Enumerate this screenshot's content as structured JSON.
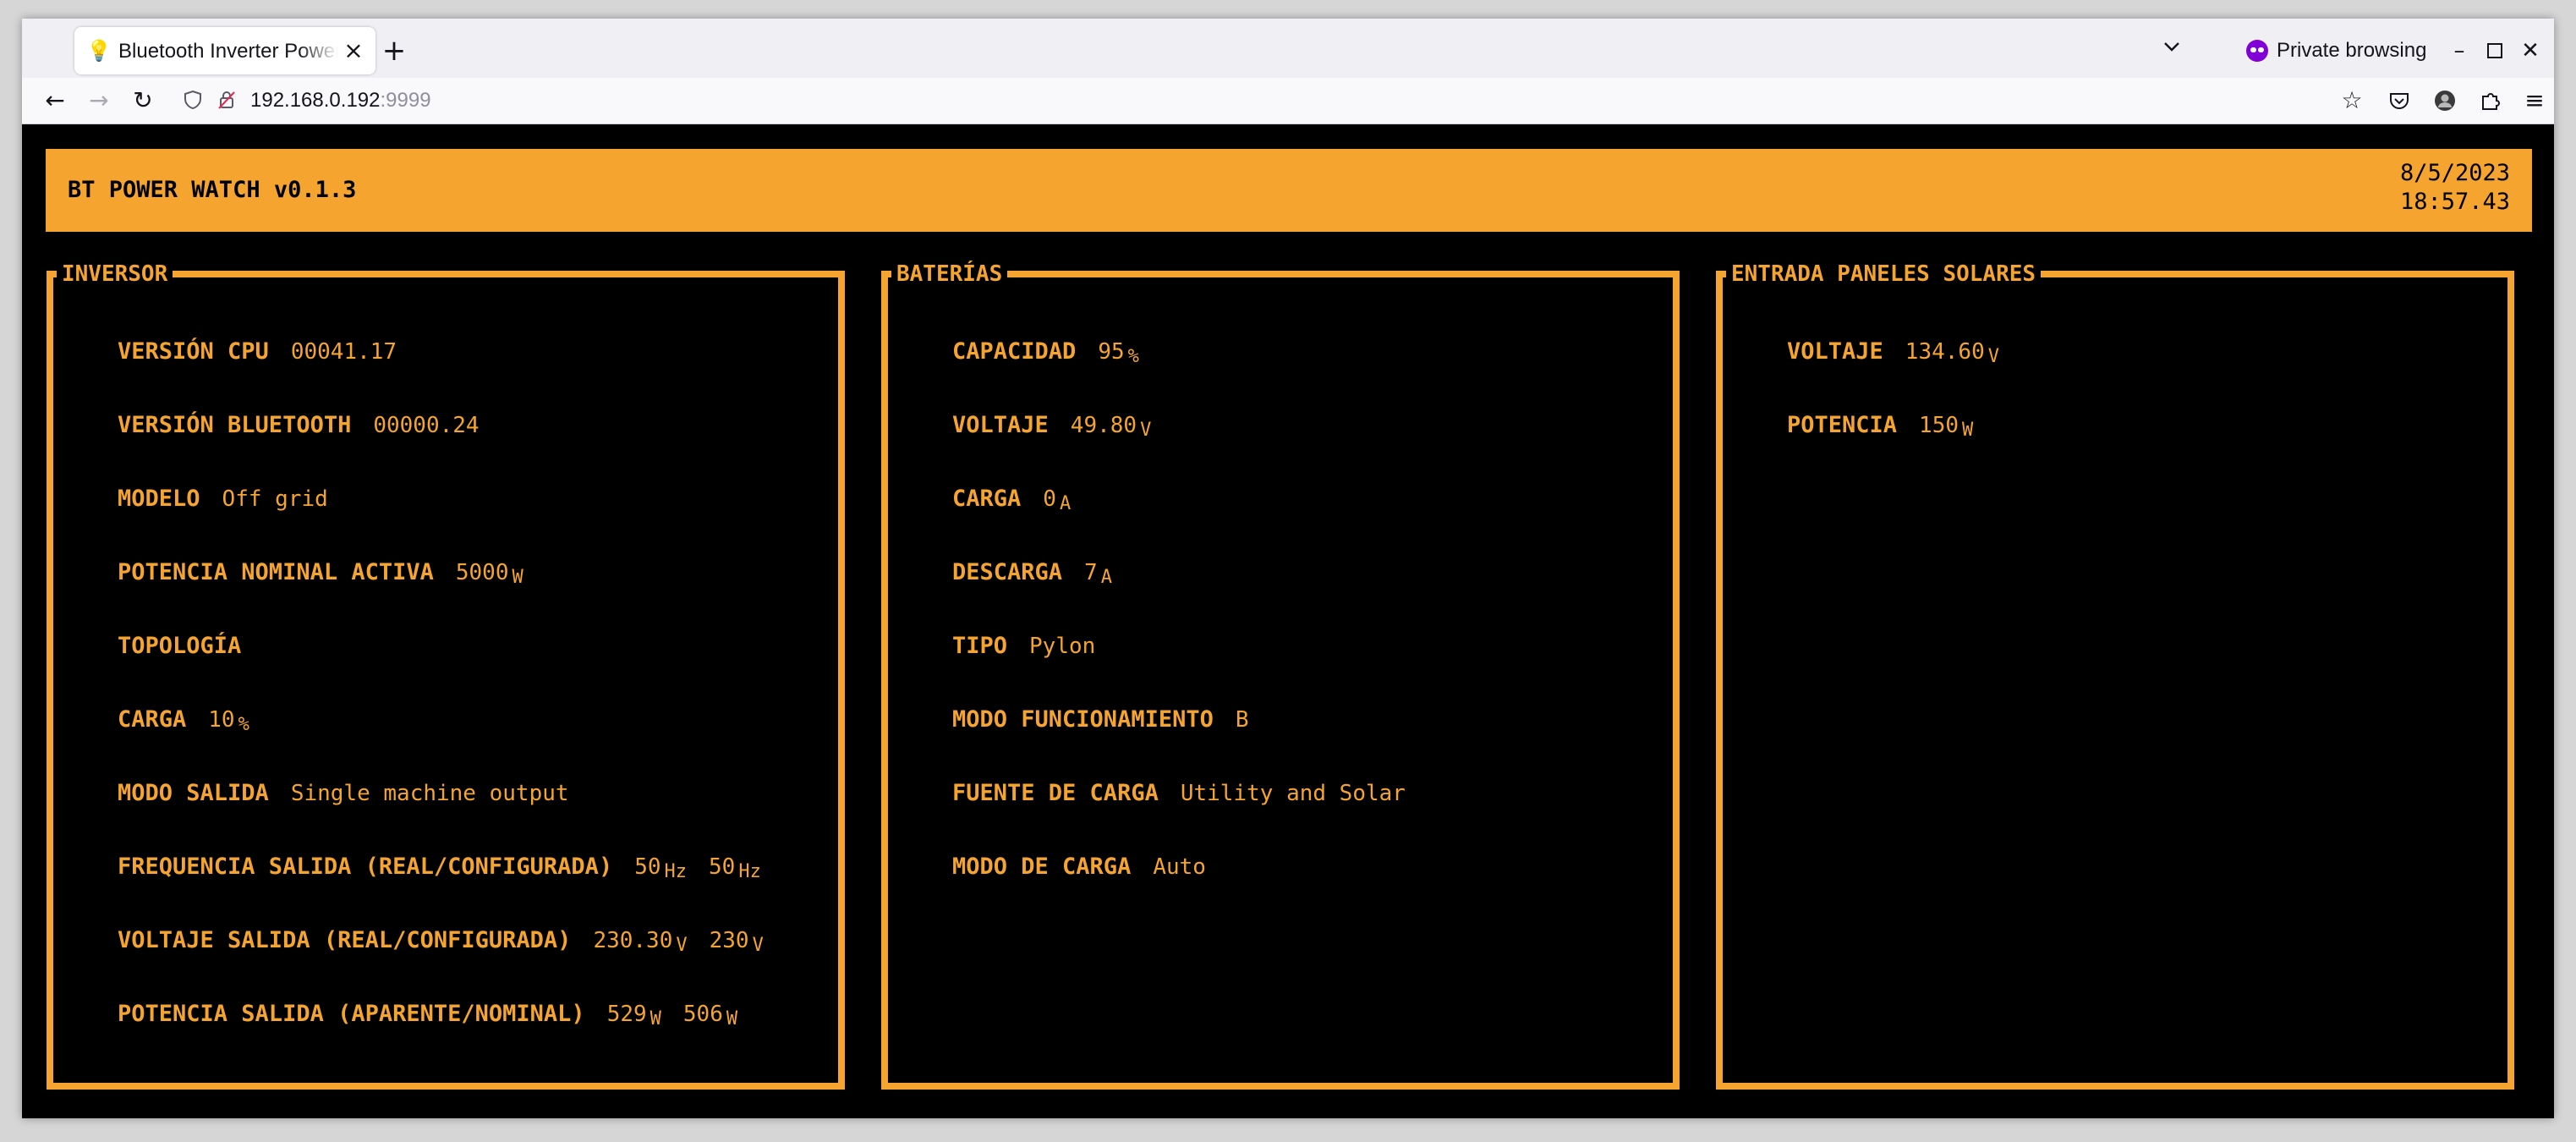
{
  "browser": {
    "tab_title": "Bluetooth Inverter Power Watch",
    "url_host": "192.168.0.192",
    "url_port": ":9999",
    "private_label": "Private browsing"
  },
  "app": {
    "title": "BT POWER WATCH v0.1.3",
    "date": "8/5/2023",
    "time": "18:57.43"
  },
  "inversor": {
    "title": "INVERSOR",
    "rows": [
      {
        "label": "VERSIÓN CPU",
        "values": [
          {
            "v": "00041.17",
            "u": ""
          }
        ]
      },
      {
        "label": "VERSIÓN BLUETOOTH",
        "values": [
          {
            "v": "00000.24",
            "u": ""
          }
        ]
      },
      {
        "label": "MODELO",
        "values": [
          {
            "v": "Off grid",
            "u": ""
          }
        ]
      },
      {
        "label": "POTENCIA NOMINAL ACTIVA",
        "values": [
          {
            "v": "5000",
            "u": "W"
          }
        ]
      },
      {
        "label": "TOPOLOGÍA",
        "values": []
      },
      {
        "label": "CARGA",
        "values": [
          {
            "v": "10",
            "u": "%"
          }
        ]
      },
      {
        "label": "MODO SALIDA",
        "values": [
          {
            "v": "Single machine output",
            "u": ""
          }
        ]
      },
      {
        "label": "FREQUENCIA SALIDA (REAL/CONFIGURADA)",
        "values": [
          {
            "v": "50",
            "u": "Hz"
          },
          {
            "v": "50",
            "u": "Hz"
          }
        ]
      },
      {
        "label": "VOLTAJE SALIDA (REAL/CONFIGURADA)",
        "values": [
          {
            "v": "230.30",
            "u": "V"
          },
          {
            "v": "230",
            "u": "V"
          }
        ]
      },
      {
        "label": "POTENCIA SALIDA (APARENTE/NOMINAL)",
        "values": [
          {
            "v": "529",
            "u": "W"
          },
          {
            "v": "506",
            "u": "W"
          }
        ]
      }
    ]
  },
  "baterias": {
    "title": "BATERÍAS",
    "rows": [
      {
        "label": "CAPACIDAD",
        "values": [
          {
            "v": "95",
            "u": "%"
          }
        ]
      },
      {
        "label": "VOLTAJE",
        "values": [
          {
            "v": "49.80",
            "u": "V"
          }
        ]
      },
      {
        "label": "CARGA",
        "values": [
          {
            "v": "0",
            "u": "A"
          }
        ]
      },
      {
        "label": "DESCARGA",
        "values": [
          {
            "v": "7",
            "u": "A"
          }
        ]
      },
      {
        "label": "TIPO",
        "values": [
          {
            "v": "Pylon",
            "u": ""
          }
        ]
      },
      {
        "label": "MODO FUNCIONAMIENTO",
        "values": [
          {
            "v": "B",
            "u": ""
          }
        ]
      },
      {
        "label": "FUENTE DE CARGA",
        "values": [
          {
            "v": "Utility and Solar",
            "u": ""
          }
        ]
      },
      {
        "label": "MODO DE CARGA",
        "values": [
          {
            "v": "Auto",
            "u": ""
          }
        ]
      }
    ]
  },
  "solar": {
    "title": "ENTRADA PANELES SOLARES",
    "rows": [
      {
        "label": "VOLTAJE",
        "values": [
          {
            "v": "134.60",
            "u": "V"
          }
        ]
      },
      {
        "label": "POTENCIA",
        "values": [
          {
            "v": "150",
            "u": "W"
          }
        ]
      }
    ]
  },
  "colors": {
    "accent": "#f5a52f",
    "background": "#000000"
  }
}
